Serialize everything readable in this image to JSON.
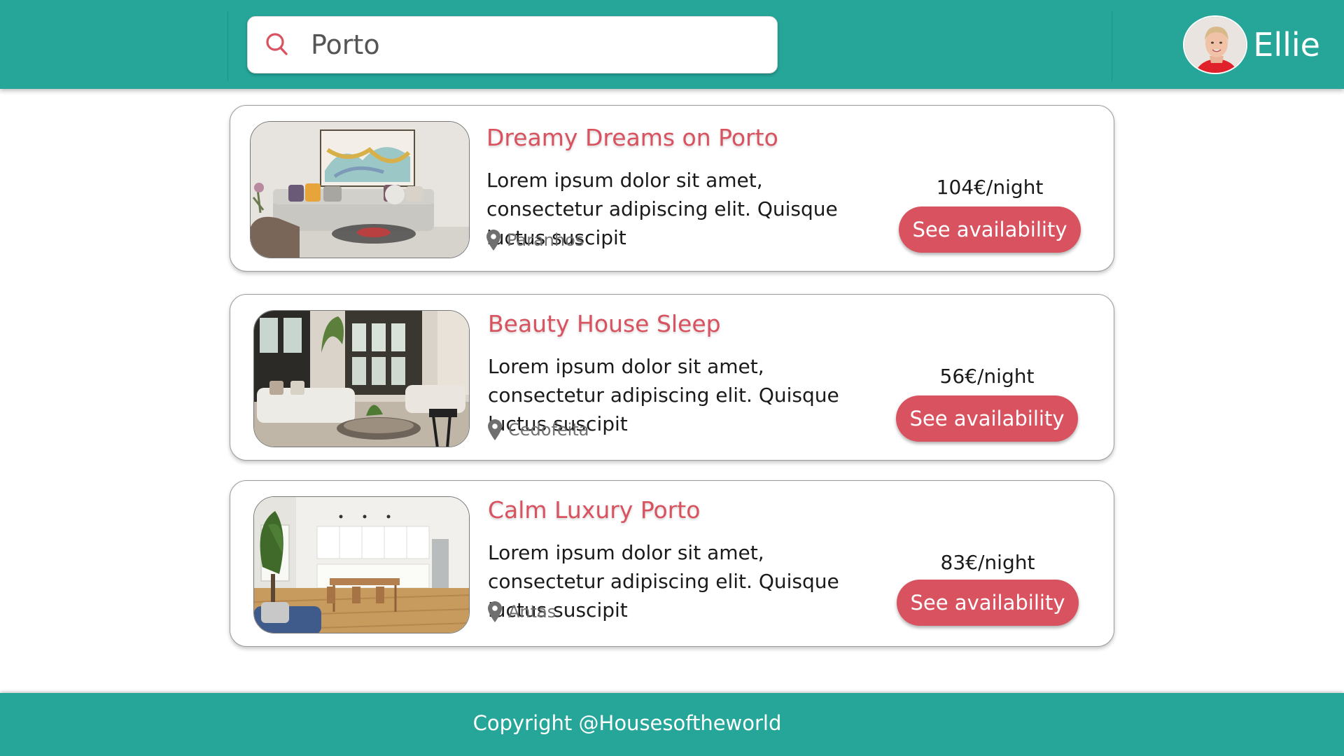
{
  "colors": {
    "header_bg": "#25a699",
    "accent": "#d9525f",
    "footer_bg": "#25a699"
  },
  "header": {
    "search": {
      "value": "Porto",
      "icon": "search-icon"
    },
    "user": {
      "name": "Ellie",
      "avatar": "user-avatar"
    }
  },
  "listings": [
    {
      "title": "Dreamy Dreams on Porto",
      "description": "Lorem ipsum dolor sit amet, consectetur adipiscing elit. Quisque luctus suscipit",
      "location": "Paranhos",
      "price": "104€/night",
      "button": "See availability"
    },
    {
      "title": "Beauty House Sleep",
      "description": "Lorem ipsum dolor sit amet, consectetur adipiscing elit. Quisque luctus suscipit",
      "location": "Cedofeita",
      "price": "56€/night",
      "button": "See availability"
    },
    {
      "title": "Calm Luxury Porto",
      "description": "Lorem ipsum dolor sit amet, consectetur adipiscing elit. Quisque luctus suscipit",
      "location": "Antas",
      "price": "83€/night",
      "button": "See availability"
    }
  ],
  "footer": {
    "copyright": "Copyright @Housesoftheworld"
  }
}
